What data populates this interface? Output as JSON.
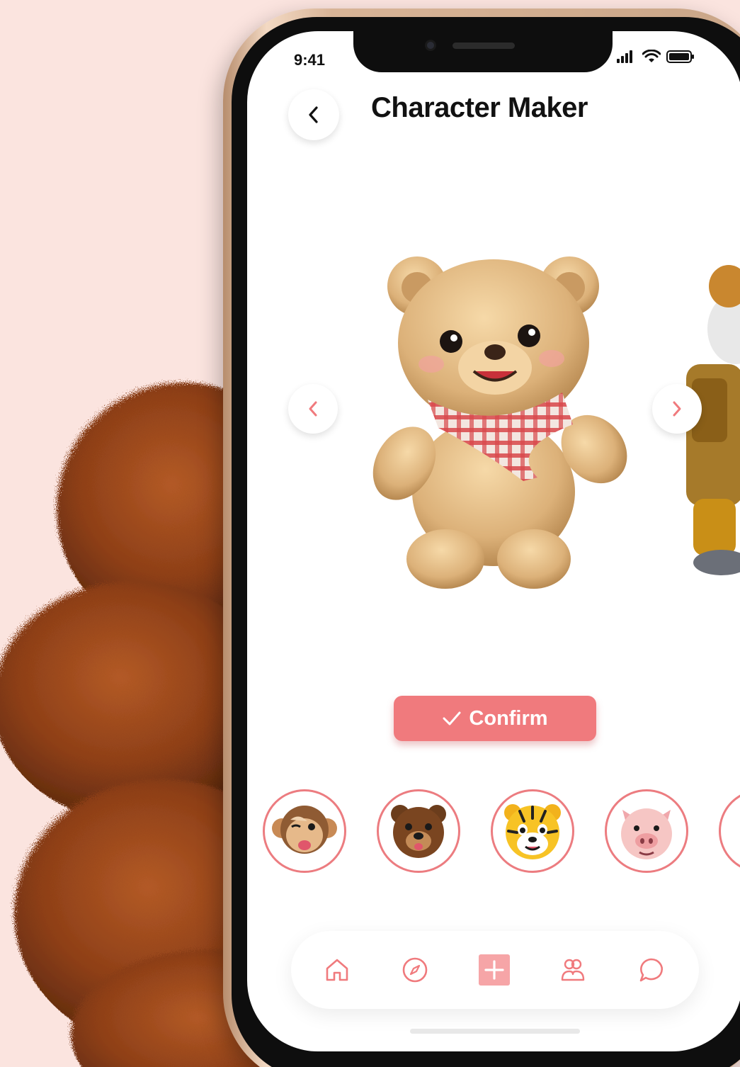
{
  "status_bar": {
    "time": "9:41"
  },
  "header": {
    "title": "Character Maker",
    "back_icon": "chevron-left-icon"
  },
  "carousel": {
    "prev_icon": "chevron-left-icon",
    "next_icon": "chevron-right-icon",
    "current_character": "teddy bear with red plaid scarf"
  },
  "confirm": {
    "label": "Confirm",
    "icon": "check-icon"
  },
  "avatars": [
    {
      "name": "monkey",
      "selected": false
    },
    {
      "name": "bear",
      "selected": false
    },
    {
      "name": "tiger",
      "selected": false
    },
    {
      "name": "pig",
      "selected": false
    }
  ],
  "tabbar": {
    "items": [
      {
        "icon": "home-icon"
      },
      {
        "icon": "compass-icon"
      },
      {
        "icon": "plus-icon",
        "active": true
      },
      {
        "icon": "users-icon"
      },
      {
        "icon": "chat-icon"
      }
    ]
  },
  "colors": {
    "accent": "#f07a7d",
    "background": "#fbe4df",
    "avatar_ring": "#ec7c80"
  }
}
